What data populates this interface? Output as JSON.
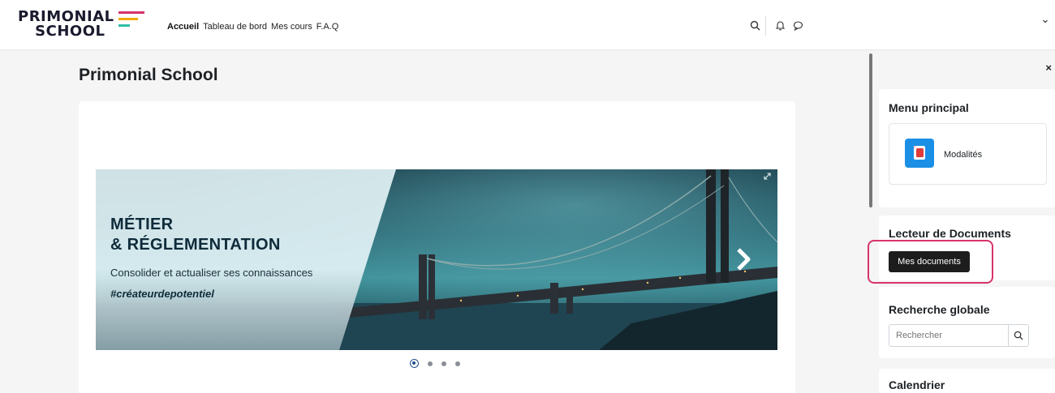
{
  "brand": {
    "line1": "PRIMONIAL",
    "line2": "SCHOOL",
    "bar_colors": [
      "#d6336c",
      "#f2a900",
      "#2fbfa7"
    ]
  },
  "nav": {
    "items": [
      {
        "label": "Accueil",
        "active": true
      },
      {
        "label": "Tableau de bord",
        "active": false
      },
      {
        "label": "Mes cours",
        "active": false
      },
      {
        "label": "F.A.Q",
        "active": false
      }
    ],
    "icons": [
      "search-icon",
      "bell-icon",
      "chat-icon",
      "chevron-down-icon"
    ]
  },
  "main": {
    "title": "Primonial School",
    "banner": {
      "heading_line1": "MÉTIER",
      "heading_line2": "& RÉGLEMENTATION",
      "subtitle": "Consolider et actualiser ses connaissances",
      "hashtag": "#créateurdepotentiel"
    },
    "carousel": {
      "count": 4,
      "active_index": 0
    }
  },
  "drawer": {
    "close_glyph": "×",
    "menu_principal": {
      "title": "Menu principal",
      "item_label": "Modalités"
    },
    "lecteur": {
      "title": "Lecteur de Documents",
      "button_label": "Mes documents"
    },
    "recherche": {
      "title": "Recherche globale",
      "placeholder": "Rechercher"
    },
    "calendrier": {
      "title": "Calendrier"
    }
  },
  "colors": {
    "accent_highlight": "#d6336c",
    "activity_icon": "#1b8fe6",
    "dark_button": "#1d1d1d"
  }
}
